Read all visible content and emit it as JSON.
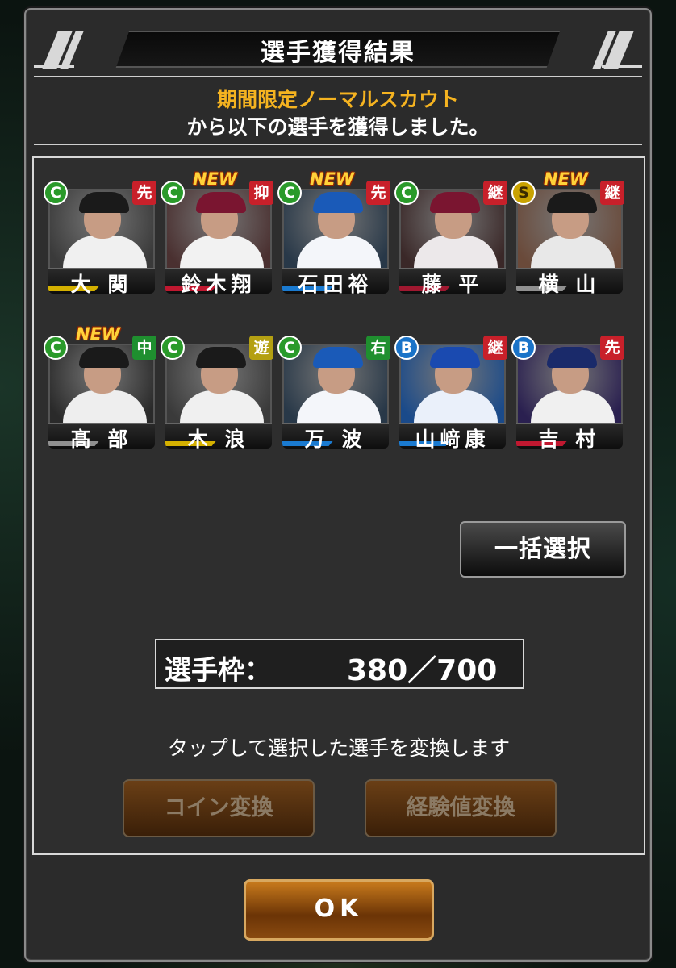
{
  "dialog": {
    "title": "選手獲得結果",
    "scout_name": "期間限定ノーマルスカウト",
    "result_message": "から以下の選手を獲得しました。"
  },
  "players": [
    {
      "name": "大 関",
      "rank": "C",
      "position": "先",
      "is_new": false,
      "pos_color": "#c8202a",
      "stripe_color": "#d4b000",
      "photo_bg": "#3a3a3a",
      "cap_color": "#1a1a1a",
      "uniform_color": "#f0f0f0"
    },
    {
      "name": "鈴木翔",
      "rank": "C",
      "position": "抑",
      "is_new": true,
      "pos_color": "#c8202a",
      "stripe_color": "#c01830",
      "photo_bg": "#4a3030",
      "cap_color": "#7a1530",
      "uniform_color": "#f2f2f2"
    },
    {
      "name": "石田裕",
      "rank": "C",
      "position": "先",
      "is_new": true,
      "pos_color": "#c8202a",
      "stripe_color": "#1a7ad0",
      "photo_bg": "#283848",
      "cap_color": "#1a5ab8",
      "uniform_color": "#f4f6fa"
    },
    {
      "name": "藤 平",
      "rank": "C",
      "position": "継",
      "is_new": false,
      "pos_color": "#c8202a",
      "stripe_color": "#a01830",
      "photo_bg": "#3a2828",
      "cap_color": "#7a1530",
      "uniform_color": "#ece8ea"
    },
    {
      "name": "横 山",
      "rank": "S",
      "position": "継",
      "is_new": true,
      "pos_color": "#c8202a",
      "stripe_color": "#909090",
      "photo_bg": "#6a4a3a",
      "cap_color": "#1a1a1a",
      "uniform_color": "#e8e8e8"
    },
    {
      "name": "髙 部",
      "rank": "C",
      "position": "中",
      "is_new": true,
      "pos_color": "#1f8f2f",
      "stripe_color": "#909090",
      "photo_bg": "#2a2a2a",
      "cap_color": "#1a1a1a",
      "uniform_color": "#eeeeee"
    },
    {
      "name": "木 浪",
      "rank": "C",
      "position": "遊",
      "is_new": false,
      "pos_color": "#b4a012",
      "stripe_color": "#d4b000",
      "photo_bg": "#3a3a3a",
      "cap_color": "#1a1a1a",
      "uniform_color": "#f0f0f0"
    },
    {
      "name": "万 波",
      "rank": "C",
      "position": "右",
      "is_new": false,
      "pos_color": "#1f8f2f",
      "stripe_color": "#1a7ad0",
      "photo_bg": "#283848",
      "cap_color": "#1a5ab8",
      "uniform_color": "#f4f6fa"
    },
    {
      "name": "山﨑康",
      "rank": "B",
      "position": "継",
      "is_new": false,
      "pos_color": "#c8202a",
      "stripe_color": "#1a7ad0",
      "photo_bg": "#1a4a8a",
      "cap_color": "#1a4ab0",
      "uniform_color": "#eaf0fa"
    },
    {
      "name": "吉 村",
      "rank": "B",
      "position": "先",
      "is_new": false,
      "pos_color": "#c8202a",
      "stripe_color": "#c01830",
      "photo_bg": "#2a2050",
      "cap_color": "#1a2a6a",
      "uniform_color": "#f0f0f0"
    }
  ],
  "new_label": "NEW",
  "bulk_select_label": "一括選択",
  "slots": {
    "label": "選手枠：",
    "value": "380／700"
  },
  "hint": "タップして選択した選手を変換します",
  "coin_convert_label": "コイン変換",
  "exp_convert_label": "経験値変換",
  "ok_label": "OK"
}
